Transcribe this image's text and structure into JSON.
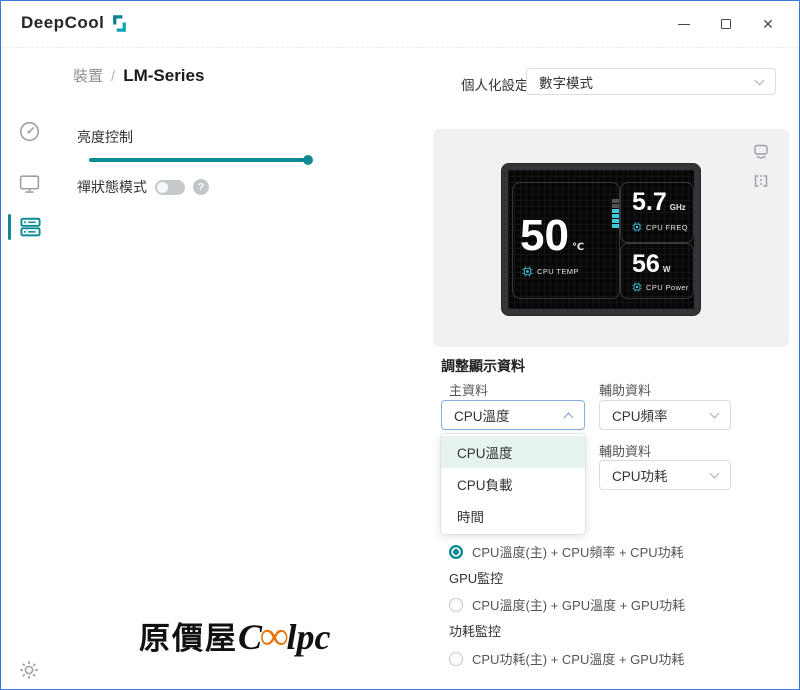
{
  "colors": {
    "accent_teal": "#0f8a94",
    "screen_cyan": "#3fc9de",
    "window_border_blue": "#3b79d6",
    "dropdown_highlight": "#e7f3f0",
    "watermark_orange": "#e8720c"
  },
  "window": {
    "logo_text": "DeepCool",
    "controls": {
      "minimize": "minimize",
      "maximize": "maximize",
      "close": "✕"
    }
  },
  "sidebar": {
    "items": [
      {
        "icon": "gauge-icon"
      },
      {
        "icon": "monitor-icon"
      },
      {
        "icon": "devices-icon",
        "active": true
      },
      {
        "icon": "gear-icon"
      }
    ]
  },
  "header": {
    "breadcrumb_section": "裝置",
    "breadcrumb_sep": "/",
    "breadcrumb_page": "LM-Series",
    "personalize_label": "個人化設定",
    "personalize_value": "數字模式"
  },
  "controls": {
    "brightness_label": "亮度控制",
    "brightness_percent": 100,
    "zen_label": "禪狀態模式",
    "zen_enabled": false,
    "help_glyph": "?"
  },
  "preview": {
    "cpu_temp": {
      "value": "50",
      "unit": "℃",
      "label": "CPU TEMP"
    },
    "cpu_freq": {
      "value": "5.7",
      "unit": "GHz",
      "label": "CPU FREQ"
    },
    "cpu_power": {
      "value": "56",
      "unit": "W",
      "label": "CPU Power"
    }
  },
  "display_settings": {
    "section_title": "調整顯示資料",
    "primary_label": "主資料",
    "primary_value": "CPU溫度",
    "aux1_label": "輔助資料",
    "aux1_value": "CPU頻率",
    "aux2_label": "輔助資料",
    "aux2_value": "CPU功耗",
    "dropdown_options": [
      {
        "label": "CPU溫度",
        "selected": true
      },
      {
        "label": "CPU負載",
        "selected": false
      },
      {
        "label": "時間",
        "selected": false
      }
    ],
    "presets": [
      {
        "kind": "radio",
        "checked": true,
        "label": "CPU溫度(主) + CPU頻率 + CPU功耗"
      },
      {
        "kind": "group",
        "label": "GPU監控"
      },
      {
        "kind": "radio",
        "checked": false,
        "label": "CPU溫度(主) + GPU溫度 + GPU功耗"
      },
      {
        "kind": "group",
        "label": "功耗監控"
      },
      {
        "kind": "radio",
        "checked": false,
        "label": "CPU功耗(主) + CPU溫度 + GPU功耗"
      }
    ]
  },
  "watermark": {
    "prefix": "原價屋",
    "c": "C",
    "infinity": "∞",
    "suffix": "lpc"
  }
}
